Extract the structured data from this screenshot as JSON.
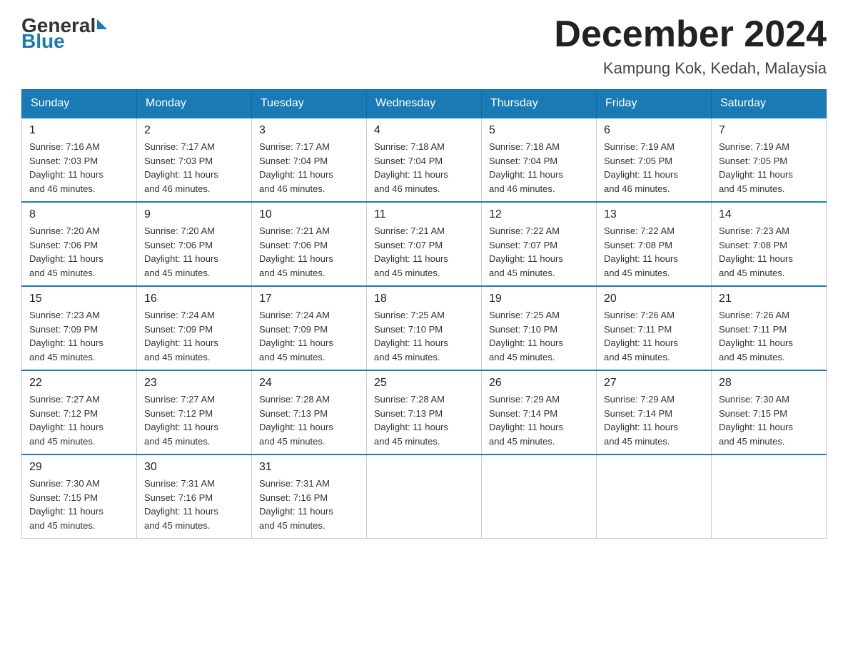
{
  "header": {
    "logo_general": "General",
    "logo_blue": "Blue",
    "title": "December 2024",
    "location": "Kampung Kok, Kedah, Malaysia"
  },
  "days_of_week": [
    "Sunday",
    "Monday",
    "Tuesday",
    "Wednesday",
    "Thursday",
    "Friday",
    "Saturday"
  ],
  "weeks": [
    [
      {
        "day": "1",
        "sunrise": "7:16 AM",
        "sunset": "7:03 PM",
        "daylight": "11 hours and 46 minutes."
      },
      {
        "day": "2",
        "sunrise": "7:17 AM",
        "sunset": "7:03 PM",
        "daylight": "11 hours and 46 minutes."
      },
      {
        "day": "3",
        "sunrise": "7:17 AM",
        "sunset": "7:04 PM",
        "daylight": "11 hours and 46 minutes."
      },
      {
        "day": "4",
        "sunrise": "7:18 AM",
        "sunset": "7:04 PM",
        "daylight": "11 hours and 46 minutes."
      },
      {
        "day": "5",
        "sunrise": "7:18 AM",
        "sunset": "7:04 PM",
        "daylight": "11 hours and 46 minutes."
      },
      {
        "day": "6",
        "sunrise": "7:19 AM",
        "sunset": "7:05 PM",
        "daylight": "11 hours and 46 minutes."
      },
      {
        "day": "7",
        "sunrise": "7:19 AM",
        "sunset": "7:05 PM",
        "daylight": "11 hours and 45 minutes."
      }
    ],
    [
      {
        "day": "8",
        "sunrise": "7:20 AM",
        "sunset": "7:06 PM",
        "daylight": "11 hours and 45 minutes."
      },
      {
        "day": "9",
        "sunrise": "7:20 AM",
        "sunset": "7:06 PM",
        "daylight": "11 hours and 45 minutes."
      },
      {
        "day": "10",
        "sunrise": "7:21 AM",
        "sunset": "7:06 PM",
        "daylight": "11 hours and 45 minutes."
      },
      {
        "day": "11",
        "sunrise": "7:21 AM",
        "sunset": "7:07 PM",
        "daylight": "11 hours and 45 minutes."
      },
      {
        "day": "12",
        "sunrise": "7:22 AM",
        "sunset": "7:07 PM",
        "daylight": "11 hours and 45 minutes."
      },
      {
        "day": "13",
        "sunrise": "7:22 AM",
        "sunset": "7:08 PM",
        "daylight": "11 hours and 45 minutes."
      },
      {
        "day": "14",
        "sunrise": "7:23 AM",
        "sunset": "7:08 PM",
        "daylight": "11 hours and 45 minutes."
      }
    ],
    [
      {
        "day": "15",
        "sunrise": "7:23 AM",
        "sunset": "7:09 PM",
        "daylight": "11 hours and 45 minutes."
      },
      {
        "day": "16",
        "sunrise": "7:24 AM",
        "sunset": "7:09 PM",
        "daylight": "11 hours and 45 minutes."
      },
      {
        "day": "17",
        "sunrise": "7:24 AM",
        "sunset": "7:09 PM",
        "daylight": "11 hours and 45 minutes."
      },
      {
        "day": "18",
        "sunrise": "7:25 AM",
        "sunset": "7:10 PM",
        "daylight": "11 hours and 45 minutes."
      },
      {
        "day": "19",
        "sunrise": "7:25 AM",
        "sunset": "7:10 PM",
        "daylight": "11 hours and 45 minutes."
      },
      {
        "day": "20",
        "sunrise": "7:26 AM",
        "sunset": "7:11 PM",
        "daylight": "11 hours and 45 minutes."
      },
      {
        "day": "21",
        "sunrise": "7:26 AM",
        "sunset": "7:11 PM",
        "daylight": "11 hours and 45 minutes."
      }
    ],
    [
      {
        "day": "22",
        "sunrise": "7:27 AM",
        "sunset": "7:12 PM",
        "daylight": "11 hours and 45 minutes."
      },
      {
        "day": "23",
        "sunrise": "7:27 AM",
        "sunset": "7:12 PM",
        "daylight": "11 hours and 45 minutes."
      },
      {
        "day": "24",
        "sunrise": "7:28 AM",
        "sunset": "7:13 PM",
        "daylight": "11 hours and 45 minutes."
      },
      {
        "day": "25",
        "sunrise": "7:28 AM",
        "sunset": "7:13 PM",
        "daylight": "11 hours and 45 minutes."
      },
      {
        "day": "26",
        "sunrise": "7:29 AM",
        "sunset": "7:14 PM",
        "daylight": "11 hours and 45 minutes."
      },
      {
        "day": "27",
        "sunrise": "7:29 AM",
        "sunset": "7:14 PM",
        "daylight": "11 hours and 45 minutes."
      },
      {
        "day": "28",
        "sunrise": "7:30 AM",
        "sunset": "7:15 PM",
        "daylight": "11 hours and 45 minutes."
      }
    ],
    [
      {
        "day": "29",
        "sunrise": "7:30 AM",
        "sunset": "7:15 PM",
        "daylight": "11 hours and 45 minutes."
      },
      {
        "day": "30",
        "sunrise": "7:31 AM",
        "sunset": "7:16 PM",
        "daylight": "11 hours and 45 minutes."
      },
      {
        "day": "31",
        "sunrise": "7:31 AM",
        "sunset": "7:16 PM",
        "daylight": "11 hours and 45 minutes."
      },
      null,
      null,
      null,
      null
    ]
  ],
  "labels": {
    "sunrise": "Sunrise: ",
    "sunset": "Sunset: ",
    "daylight": "Daylight: "
  }
}
